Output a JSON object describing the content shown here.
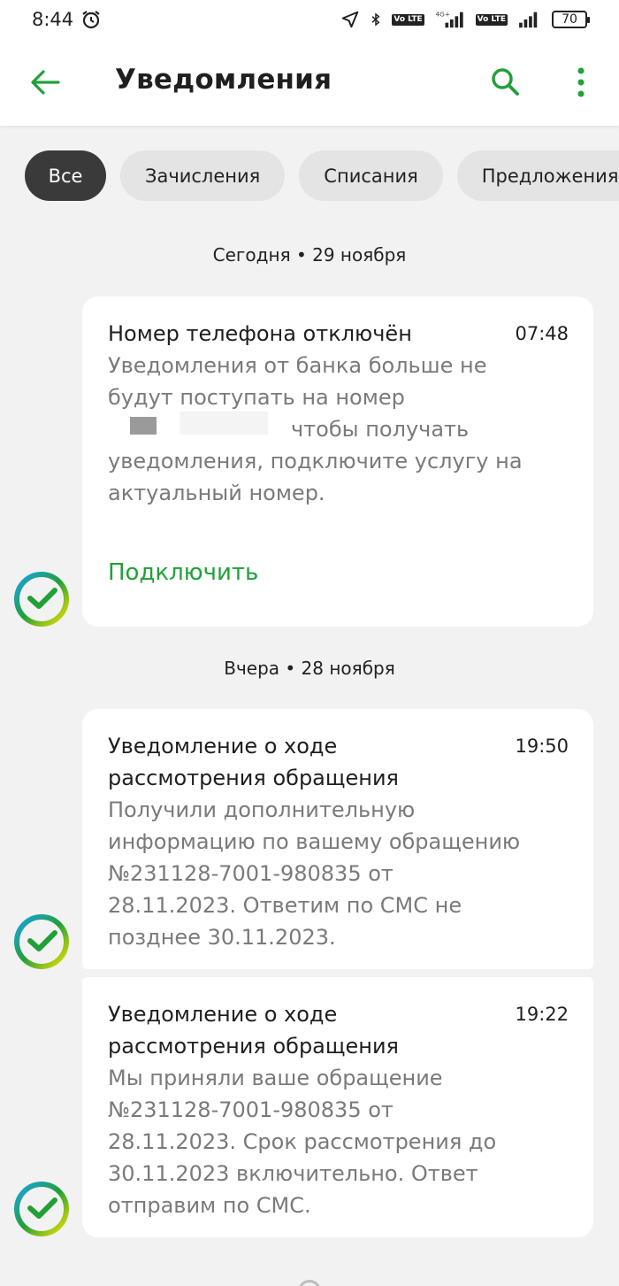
{
  "status_bar": {
    "time": "8:44",
    "battery": "70",
    "lte_label": "Vo LTE",
    "network": "4G+"
  },
  "app_bar": {
    "title": "Уведомления"
  },
  "filters": [
    {
      "label": "Все",
      "active": true
    },
    {
      "label": "Зачисления",
      "active": false
    },
    {
      "label": "Списания",
      "active": false
    },
    {
      "label": "Предложения",
      "active": false
    }
  ],
  "groups": [
    {
      "date_label": "Сегодня • 29 ноября",
      "notifications": [
        {
          "title": "Номер телефона отключён",
          "time": "07:48",
          "body_lines": [
            "Уведомления от банка больше не",
            "будут поступать на номер",
            "чтобы получать",
            "уведомления, подключите услугу на",
            "актуальный номер."
          ],
          "action": "Подключить"
        }
      ]
    },
    {
      "date_label": "Вчера • 28 ноября",
      "notifications": [
        {
          "title_lines": [
            "Уведомление о ходе",
            "рассмотрения обращения"
          ],
          "time": "19:50",
          "body_lines": [
            "Получили дополнительную",
            "информацию по вашему обращению",
            "№231128-7001-980835 от",
            "28.11.2023. Ответим по СМС не",
            "позднее 30.11.2023."
          ]
        },
        {
          "title_lines": [
            "Уведомление о ходе",
            "рассмотрения обращения"
          ],
          "time": "19:22",
          "body_lines": [
            "Мы приняли ваше обращение",
            "№231128-7001-980835 от",
            "28.11.2023. Срок рассмотрения до",
            "30.11.2023 включительно. Ответ",
            "отправим по СМС."
          ]
        }
      ]
    }
  ],
  "colors": {
    "accent_green": "#21a038",
    "chip_active_bg": "#3a3a3a",
    "chip_bg": "#e4e4e4",
    "page_bg": "#f2f2f2"
  },
  "icons": {
    "back": "arrow-left-icon",
    "search": "search-icon",
    "more": "more-vertical-icon",
    "sender": "sber-logo-icon"
  }
}
